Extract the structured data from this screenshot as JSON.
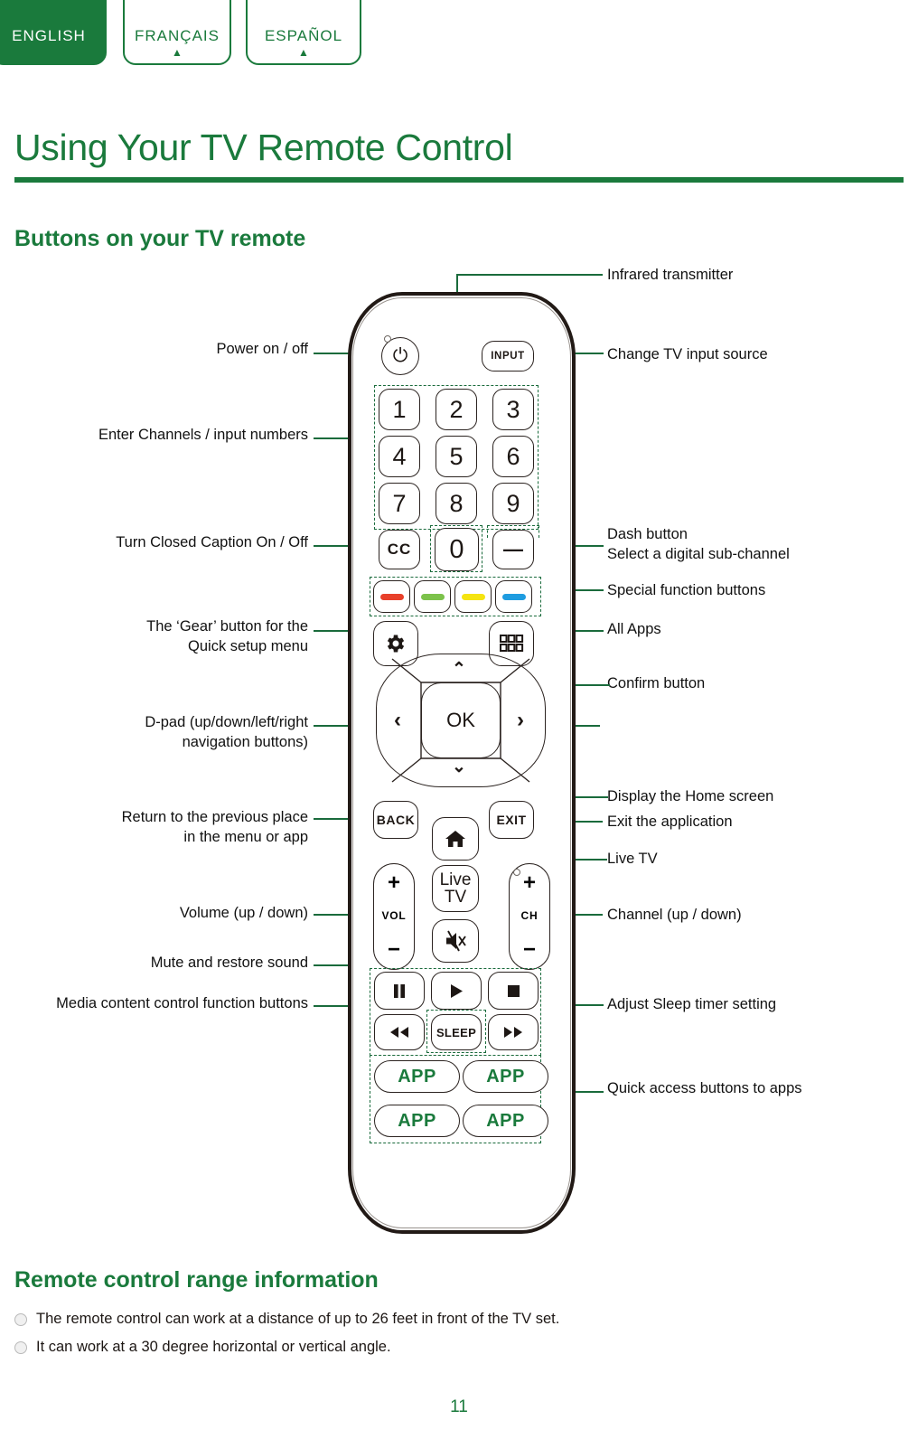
{
  "language_tabs": [
    {
      "label": "ENGLISH",
      "active": true,
      "caret": "▲"
    },
    {
      "label": "FRANÇAIS",
      "active": false,
      "caret": "▲"
    },
    {
      "label": "ESPAÑOL",
      "active": false,
      "caret": "▲"
    }
  ],
  "page": {
    "title": "Using Your TV Remote Control",
    "section_title": "Buttons on your TV remote",
    "range_title": "Remote control range information",
    "number": "11"
  },
  "range_bullets": [
    "The remote control can work at a distance of up to 26 feet in front of the TV set.",
    "It can work at a 30 degree horizontal or vertical angle."
  ],
  "annotations": {
    "left": [
      {
        "text": "Power on / off"
      },
      {
        "text": "Enter Channels / input numbers"
      },
      {
        "text": "Turn Closed Caption On / Off"
      },
      {
        "text": "The ‘Gear’ button for the"
      },
      {
        "text": "Quick setup menu"
      },
      {
        "text": "D-pad (up/down/left/right"
      },
      {
        "text": "navigation buttons)"
      },
      {
        "text": "Return to the previous place"
      },
      {
        "text": "in the menu or app"
      },
      {
        "text": "Volume (up / down)"
      },
      {
        "text": "Mute and restore sound"
      },
      {
        "text": "Media content control function buttons"
      }
    ],
    "right": [
      {
        "text": "Infrared transmitter"
      },
      {
        "text": "Change TV input source"
      },
      {
        "text": "Dash button"
      },
      {
        "text": "Select a digital sub-channel"
      },
      {
        "text": "Special function buttons"
      },
      {
        "text": "All Apps"
      },
      {
        "text": "Confirm button"
      },
      {
        "text": "Display the Home screen"
      },
      {
        "text": "Exit the application"
      },
      {
        "text": "Live TV"
      },
      {
        "text": "Channel (up / down)"
      },
      {
        "text": "Adjust Sleep timer setting"
      },
      {
        "text": "Quick access buttons to apps"
      }
    ]
  },
  "remote": {
    "power_icon": "⏻",
    "input_label": "INPUT",
    "numbers": [
      "1",
      "2",
      "3",
      "4",
      "5",
      "6",
      "7",
      "8",
      "9"
    ],
    "cc_label": "CC",
    "zero_label": "0",
    "dash_label": "—",
    "color_buttons": [
      {
        "name": "red-function-button",
        "color": "#e8402a"
      },
      {
        "name": "green-function-button",
        "color": "#7cc24b"
      },
      {
        "name": "yellow-function-button",
        "color": "#f5e411"
      },
      {
        "name": "blue-function-button",
        "color": "#1e9ce0"
      }
    ],
    "gear_icon": "⚙",
    "apps_icon": "apps-grid-icon",
    "dpad": {
      "up": "⌃",
      "down": "⌄",
      "left": "‹",
      "right": "›",
      "ok": "OK"
    },
    "back_label": "BACK",
    "exit_label": "EXIT",
    "home_icon": "⌂",
    "livetv_line1": "Live",
    "livetv_line2": "TV",
    "vol_label": "VOL",
    "ch_label": "CH",
    "plus": "+",
    "minus": "−",
    "mute_icon": "mute-icon",
    "media": {
      "pause": "▐▌",
      "play": "▶",
      "stop": "■",
      "rewind": "◀◀",
      "forward": "▶▶",
      "sleep": "SLEEP"
    },
    "app_buttons": [
      "APP",
      "APP",
      "APP",
      "APP"
    ]
  },
  "colors": {
    "brand_green": "#1a7a3c",
    "leader_green": "#1a6b3c",
    "body_outline": "#221a16"
  }
}
